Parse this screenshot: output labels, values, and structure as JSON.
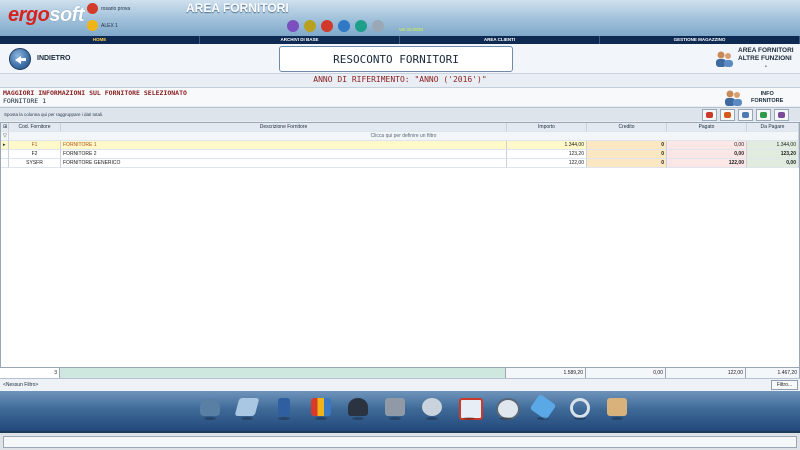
{
  "header": {
    "logo_part1": "ergo",
    "logo_part2": "soft",
    "company": "rosario prova",
    "user": "ALEX 1",
    "area_title": "AREA FORNITORI",
    "version": "Ver.16.0030",
    "toolbar_icons": [
      {
        "icon": "logout-icon",
        "color": "#7c4fc0"
      },
      {
        "icon": "info-icon",
        "color": "#b8a020"
      },
      {
        "icon": "calculator-icon",
        "color": "#d03a2a"
      },
      {
        "icon": "help-icon",
        "color": "#2f78c6"
      },
      {
        "icon": "download-icon",
        "color": "#1d9f8a"
      },
      {
        "icon": "close-icon",
        "color": "#9aa7b5"
      }
    ]
  },
  "nav": {
    "items": [
      "HOME",
      "ARCHIVI DI BASE",
      "AREA CLIENTI",
      "GESTIONE MAGAZZINO"
    ],
    "active_index": 0,
    "active_color": "#ffd24a"
  },
  "titlebar": {
    "back_label": "INDIETRO",
    "title": "RESOCONTO FORNITORI",
    "right_menu_line1": "AREA FORNITORI",
    "right_menu_line2": "ALTRE FUNZIONI",
    "right_menu_line3": "-"
  },
  "reference_year": "ANNO DI RIFERIMENTO: \"ANNO ('2016')\"",
  "supplier_info": {
    "heading": "MAGGIORI INFORMAZIONI SUL FORNITORE SELEZIONATO",
    "selected": "FORNITORE 1",
    "info_button_line1": "INFO",
    "info_button_line2": "FORNITORE"
  },
  "grid_toolbar": {
    "group_hint": "Sposta la colonna qui per raggruppare i dati totali.",
    "tools": [
      "pdf-export-icon",
      "print-icon",
      "excel-export-icon",
      "refresh-icon",
      "settings-icon"
    ]
  },
  "grid": {
    "columns": [
      "Cod. Fornitore",
      "Descrizione Fornitore",
      "Importo",
      "Credito",
      "Pagato",
      "Da Pagare"
    ],
    "filter_hint": "Clicca qui per definire un filtro",
    "rows": [
      {
        "code": "F1",
        "name": "FORNITORE 1",
        "importo": "1.344,00",
        "credito": "0",
        "pagato": "0,00",
        "da_pagare": "1.344,00"
      },
      {
        "code": "F2",
        "name": "FORNITORE 2",
        "importo": "123,20",
        "credito": "0",
        "pagato": "0,00",
        "da_pagare": "123,20"
      },
      {
        "code": "SYSFR",
        "name": "FORNITORE GENERICO",
        "importo": "122,00",
        "credito": "0",
        "pagato": "122,00",
        "da_pagare": "0,00"
      }
    ],
    "selected_marker": "▸",
    "header_marker": "⊞",
    "filter_marker": "▽"
  },
  "totals": {
    "count": "3",
    "importo": "1.589,20",
    "credito": "0,00",
    "pagato": "122,00",
    "da_pagare": "1.467,20"
  },
  "filter_bar": {
    "no_filter": "<Nessun Filtro>",
    "filter_button": "Filtro..."
  },
  "dock": {
    "icons": [
      "support-agent-icon",
      "payment-card-icon",
      "archive-binder-icon",
      "documents-icon",
      "secure-user-icon",
      "database-save-icon",
      "printer-icon",
      "calendar-icon",
      "clock-icon",
      "price-tag-icon",
      "search-icon",
      "tools-box-icon"
    ]
  }
}
